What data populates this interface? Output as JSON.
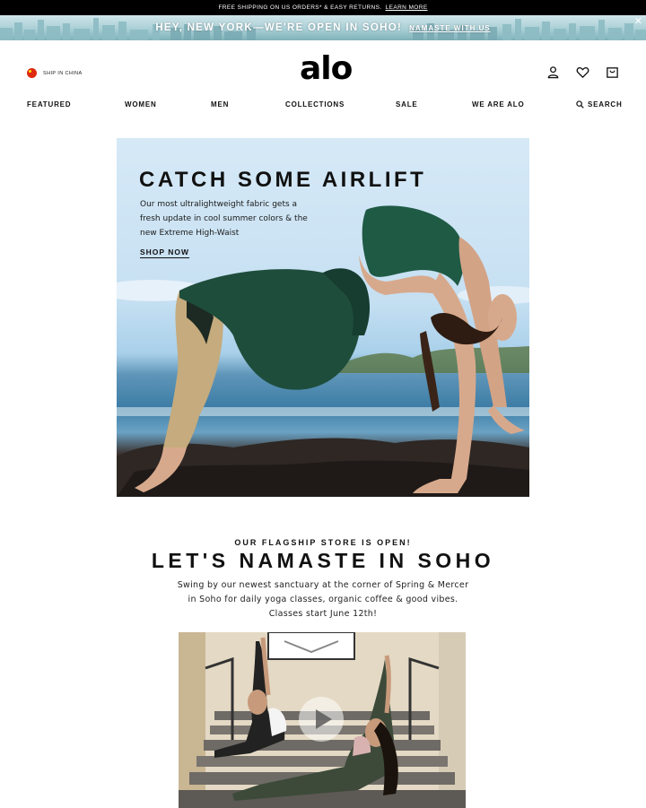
{
  "topbar": {
    "message": "FREE SHIPPING ON US ORDERS* & EASY RETURNS.",
    "link": "LEARN MORE"
  },
  "promo": {
    "message": "HEY, NEW YORK—WE'RE OPEN IN SOHO!",
    "link": "NAMASTE WITH US",
    "close_icon": "close-icon"
  },
  "header": {
    "ship_label": "SHIP IN CHINA",
    "logo": "alo",
    "icons": [
      "user-icon",
      "heart-icon",
      "bag-icon"
    ]
  },
  "nav": {
    "items": [
      "FEATURED",
      "WOMEN",
      "MEN",
      "COLLECTIONS",
      "SALE",
      "WE ARE ALO"
    ],
    "search_label": "SEARCH"
  },
  "hero": {
    "title": "CATCH SOME AIRLIFT",
    "copy": "Our most ultralightweight fabric gets a fresh update in cool summer colors & the new Extreme High-Waist",
    "cta": "SHOP NOW"
  },
  "flagship": {
    "eyebrow": "OUR FLAGSHIP STORE IS OPEN!",
    "headline": "LET'S NAMASTE IN SOHO",
    "line1": "Swing by our newest sanctuary at the corner of Spring & Mercer",
    "line2": "in Soho for daily yoga classes, organic coffee & good vibes.",
    "line3": "Classes start June 12th!"
  },
  "colors": {
    "topbar_bg": "#000000",
    "promo_bg": "#a9cfd6",
    "text": "#111111"
  }
}
